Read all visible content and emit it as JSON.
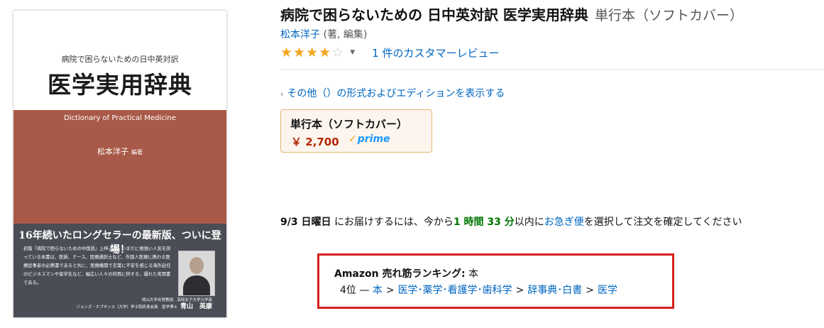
{
  "cover": {
    "pre_title": "病院で困らないための日中英対訳",
    "main_title": "医学実用辞典",
    "english_title": "Dictionary of Practical Medicine",
    "author": "松本洋子",
    "author_role": "編著",
    "headline": "16年続いたロングセラーの最新版、ついに登場！",
    "blurb": "初版『病院で困らないための中国語』上梓より、いまだに根強い人気を誇っている本書は、医師、ナース、医療通訳士など、外国人医療に携わる医療従事者の必携書であると共に、医療機関で言葉に不安を感じる海外赴任のビジネスマンや留学生など、幅広い人々の利用に供する、優れた実用書である。",
    "endorse_line1": "岡山大学名誉教授、高知女子大学元学長",
    "endorse_line2": "ジョンズ・ホプキンス（大学）学士院終身会員　医学博士",
    "endorse_name": "青山　英康"
  },
  "product": {
    "title": "病院で困らないための 日中英対訳 医学実用辞典",
    "format": "単行本（ソフトカバー）",
    "author_name": "松本洋子",
    "author_role": "(著, 編集)",
    "rating": 4,
    "rating_max": 5,
    "review_link": "1 件のカスタマーレビュー",
    "other_formats": "その他（）の形式およびエディションを表示する",
    "format_box": {
      "name": "単行本（ソフトカバー）",
      "price": "￥ 2,700",
      "prime": "prime"
    }
  },
  "delivery": {
    "date": "9/3 日曜日",
    "text1": "にお届けするには、今から",
    "time": "1 時間 33 分",
    "text2": "以内に",
    "option": "お急ぎ便",
    "text3": "を選択して注文を確定してください"
  },
  "ranking": {
    "label": "Amazon 売れ筋ランキング:",
    "category": "本",
    "rank": "4位",
    "dash": "—",
    "crumbs": [
      "本",
      "医学･薬学･看護学･歯科学",
      "辞事典･白書",
      "医学"
    ],
    "separator": ">"
  },
  "colors": {
    "link": "#0066c0",
    "price": "#b12704",
    "star": "#f4a41c",
    "highlight_border": "#d6201f",
    "delivery_time": "#007600",
    "cover_mid": "#a95948",
    "cover_bottom": "#4a4d55"
  }
}
